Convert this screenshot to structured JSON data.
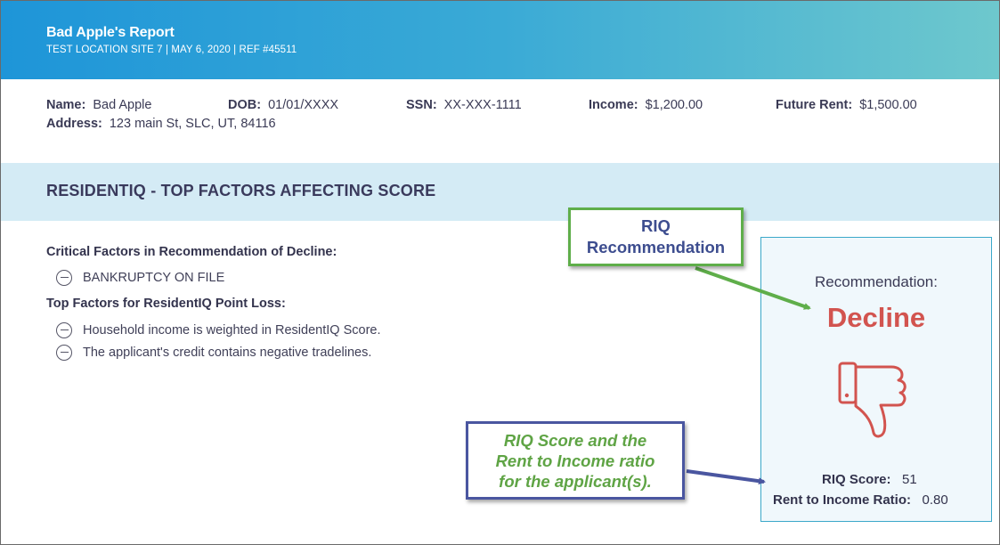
{
  "header": {
    "title": "Bad Apple's Report",
    "subtitle": "TEST LOCATION SITE 7 | MAY 6, 2020 | REF #45511"
  },
  "applicant": {
    "name_label": "Name:",
    "name": "Bad Apple",
    "dob_label": "DOB:",
    "dob": "01/01/XXXX",
    "ssn_label": "SSN:",
    "ssn": "XX-XXX-1111",
    "income_label": "Income:",
    "income": "$1,200.00",
    "future_rent_label": "Future Rent:",
    "future_rent": "$1,500.00",
    "address_label": "Address:",
    "address": "123 main St, SLC, UT, 84116"
  },
  "section": {
    "title": "RESIDENTIQ - TOP FACTORS AFFECTING SCORE"
  },
  "factors": {
    "critical_heading": "Critical Factors in Recommendation of Decline:",
    "critical_items": [
      "BANKRUPTCY ON FILE"
    ],
    "point_loss_heading": "Top Factors for ResidentIQ Point Loss:",
    "point_loss_items": [
      "Household income is weighted in ResidentIQ Score.",
      "The applicant's credit contains negative tradelines."
    ]
  },
  "recommendation": {
    "label": "Recommendation:",
    "value": "Decline",
    "icon": "thumbs-down-icon",
    "riq_score_label": "RIQ Score:",
    "riq_score": "51",
    "rent_ratio_label": "Rent to Income Ratio:",
    "rent_ratio": "0.80"
  },
  "callouts": {
    "green_line1": "RIQ",
    "green_line2": "Recommendation",
    "blue_line1": "RIQ Score and the",
    "blue_line2": "Rent to Income ratio",
    "blue_line3": "for the applicant(s)."
  },
  "colors": {
    "header_start": "#1e95d8",
    "header_end": "#6ec8cd",
    "section_bar": "#d4ebf5",
    "decline_red": "#d2544f",
    "callout_green": "#5fae4a",
    "callout_blue": "#4a56a0",
    "box_border": "#3ba8c9"
  }
}
